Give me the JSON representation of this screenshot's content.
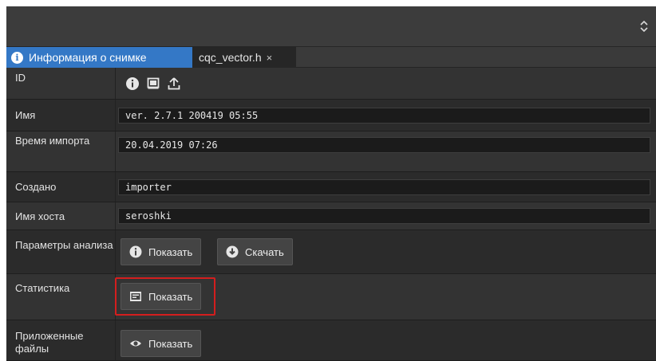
{
  "tabs": [
    {
      "label": "Информация о снимке",
      "active": true
    },
    {
      "label": "cqc_vector.h",
      "close_symbol": "×"
    }
  ],
  "rows": {
    "id": {
      "label": "ID"
    },
    "name": {
      "label": "Имя",
      "value": "ver. 2.7.1 200419 05:55"
    },
    "import_time": {
      "label": "Время импорта",
      "value": "20.04.2019 07:26"
    },
    "created": {
      "label": "Создано",
      "value": "importer"
    },
    "host": {
      "label": "Имя хоста",
      "value": "seroshki"
    },
    "analysis_params": {
      "label": "Параметры анализа",
      "show_label": "Показать",
      "download_label": "Скачать"
    },
    "statistics": {
      "label": "Статистика",
      "show_label": "Показать"
    },
    "attached_files": {
      "label": "Приложенные файлы",
      "show_label": "Показать"
    }
  },
  "colors": {
    "tab_active": "#3478c6",
    "highlight": "#d41e1e",
    "panel_bg": "#2b2b2b"
  },
  "icons": {
    "sort": "sort-updown-icon",
    "tab_info": "info-circle-icon",
    "id_buttons": [
      "info-circle-icon",
      "book-icon",
      "upload-icon"
    ],
    "analysis_show": "info-circle-icon",
    "analysis_download": "download-circle-icon",
    "statistics_show": "statistics-panel-icon",
    "files_show": "eye-icon"
  }
}
